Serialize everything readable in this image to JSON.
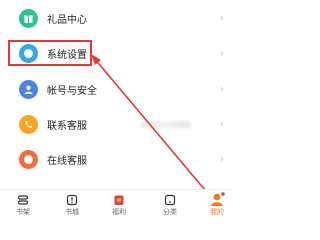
{
  "menu": {
    "items": [
      {
        "label": "礼品中心",
        "icon": "gift-icon",
        "color": "#2bc48a",
        "chevron": "›"
      },
      {
        "label": "系统设置",
        "icon": "settings-icon",
        "color": "#3aa6e6",
        "chevron": "›"
      },
      {
        "label": "帐号与安全",
        "icon": "account-security-icon",
        "color": "#4a84e8",
        "chevron": "›"
      },
      {
        "label": "联系客服",
        "icon": "contact-service-icon",
        "color": "#f5a623",
        "chevron": "›"
      },
      {
        "label": "在线客服",
        "icon": "online-service-icon",
        "color": "#f26d3d",
        "chevron": "›"
      }
    ]
  },
  "tabbar": {
    "items": [
      {
        "label": "书架",
        "icon": "bookshelf-icon",
        "active": false
      },
      {
        "label": "书城",
        "icon": "bookstore-icon",
        "active": false
      },
      {
        "label": "福利",
        "icon": "welfare-gift-icon",
        "active": false
      },
      {
        "label": "分类",
        "icon": "category-icon",
        "active": false
      },
      {
        "label": "我的",
        "icon": "profile-icon",
        "active": true
      }
    ]
  },
  "annotation": {
    "highlight_color": "#e03a3a"
  }
}
